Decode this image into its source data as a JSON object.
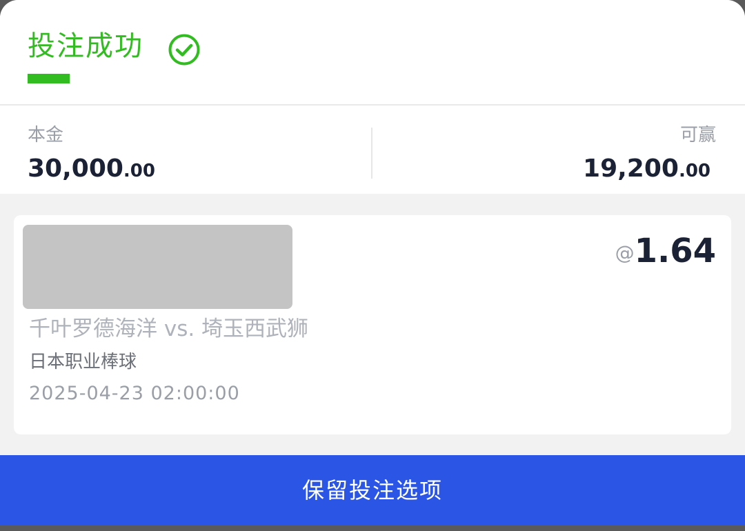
{
  "header": {
    "title": "投注成功",
    "status_icon": "check-circle-icon"
  },
  "summary": {
    "stake_label": "本金",
    "stake_int": "30,000",
    "stake_dec": ".00",
    "win_label": "可赢",
    "win_int": "19,200",
    "win_dec": ".00"
  },
  "bet": {
    "odds_prefix": "@",
    "odds": "1.64",
    "match": "千叶罗德海洋 vs. 埼玉西武狮",
    "league": "日本职业棒球",
    "datetime": "2025-04-23 02:00:00"
  },
  "actions": {
    "keep_label": "保留投注选项"
  },
  "colors": {
    "success": "#33bb22",
    "primary": "#2a55e5",
    "text_dark": "#1c2235",
    "text_muted": "#9a9ea6"
  }
}
